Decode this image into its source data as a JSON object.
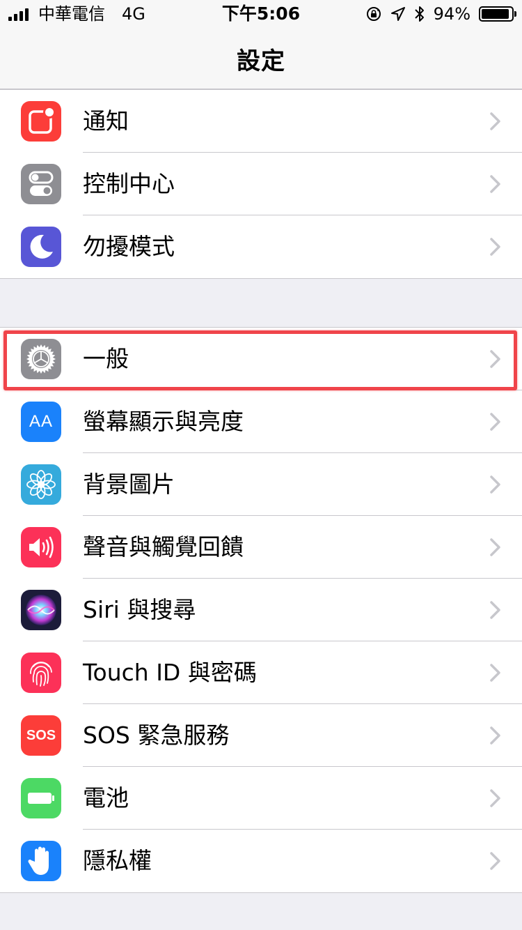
{
  "status_bar": {
    "carrier": "中華電信",
    "network": "4G",
    "time": "下午5:06",
    "battery_percent": "94%",
    "battery_level": 0.94,
    "icons": [
      "rotation-lock-icon",
      "location-arrow-icon",
      "bluetooth-icon"
    ]
  },
  "nav": {
    "title": "設定"
  },
  "groups": [
    {
      "items": [
        {
          "label": "通知",
          "icon": "notifications-icon",
          "color": "#fc3d39"
        },
        {
          "label": "控制中心",
          "icon": "control-center-icon",
          "color": "#8e8e93"
        },
        {
          "label": "勿擾模式",
          "icon": "moon-icon",
          "color": "#5856d6"
        }
      ]
    },
    {
      "items": [
        {
          "label": "一般",
          "icon": "gear-icon",
          "color": "#8e8e93",
          "highlighted": true
        },
        {
          "label": "螢幕顯示與亮度",
          "icon": "display-brightness-icon",
          "color": "#1a82fb",
          "icon_text": "AA"
        },
        {
          "label": "背景圖片",
          "icon": "wallpaper-flower-icon",
          "color": "#35aadc"
        },
        {
          "label": "聲音與觸覺回饋",
          "icon": "speaker-icon",
          "color": "#fc3158"
        },
        {
          "label": "Siri 與搜尋",
          "icon": "siri-icon",
          "color": "#1c1c3a"
        },
        {
          "label": "Touch ID 與密碼",
          "icon": "fingerprint-icon",
          "color": "#fc3158"
        },
        {
          "label": "SOS 緊急服務",
          "icon": "sos-icon",
          "color": "#fc3d39",
          "icon_text": "SOS"
        },
        {
          "label": "電池",
          "icon": "battery-icon",
          "color": "#4cd964"
        },
        {
          "label": "隱私權",
          "icon": "privacy-hand-icon",
          "color": "#1a82fb"
        }
      ]
    }
  ]
}
